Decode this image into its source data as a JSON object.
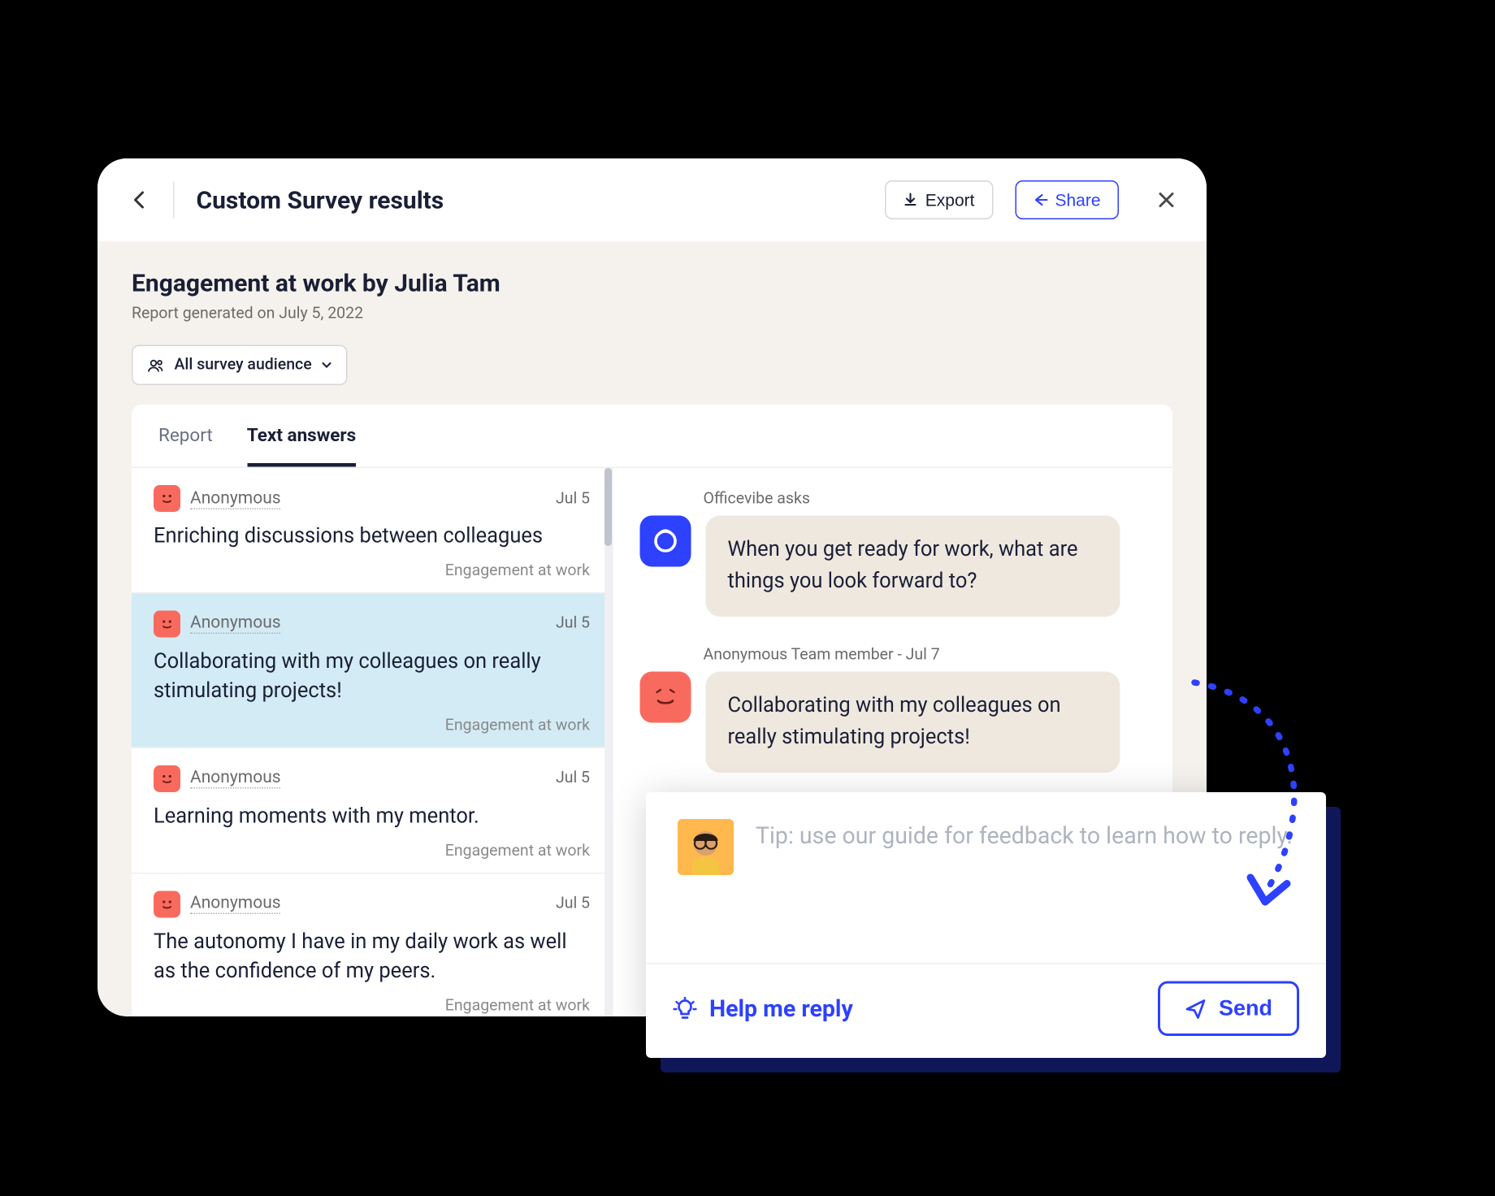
{
  "header": {
    "title": "Custom Survey results",
    "export_label": "Export",
    "share_label": "Share"
  },
  "subhead": {
    "title": "Engagement at work by Julia Tam",
    "generated": "Report generated on July 5, 2022",
    "audience_label": "All survey audience"
  },
  "tabs": {
    "report": "Report",
    "text_answers": "Text answers"
  },
  "answers": [
    {
      "author": "Anonymous",
      "date": "Jul 5",
      "text": "Enriching discussions between colleagues",
      "tag": "Engagement at work",
      "selected": false
    },
    {
      "author": "Anonymous",
      "date": "Jul 5",
      "text": "Collaborating with my colleagues on really stimulating projects!",
      "tag": "Engagement at work",
      "selected": true
    },
    {
      "author": "Anonymous",
      "date": "Jul 5",
      "text": "Learning moments with my mentor.",
      "tag": "Engagement at work",
      "selected": false
    },
    {
      "author": "Anonymous",
      "date": "Jul 5",
      "text": "The autonomy I have in my daily work as well as the confidence of my peers.",
      "tag": "Engagement at work",
      "selected": false
    }
  ],
  "thread": {
    "prompt_label": "Officevibe asks",
    "prompt_text": "When you get ready for work, what are things you look forward to?",
    "answer_label": "Anonymous Team member - Jul 7",
    "answer_text": "Collaborating with my colleagues on really stimulating projects!"
  },
  "reply": {
    "placeholder": "Tip: use our guide for feedback to learn how to reply.",
    "help_label": "Help me reply",
    "send_label": "Send"
  }
}
